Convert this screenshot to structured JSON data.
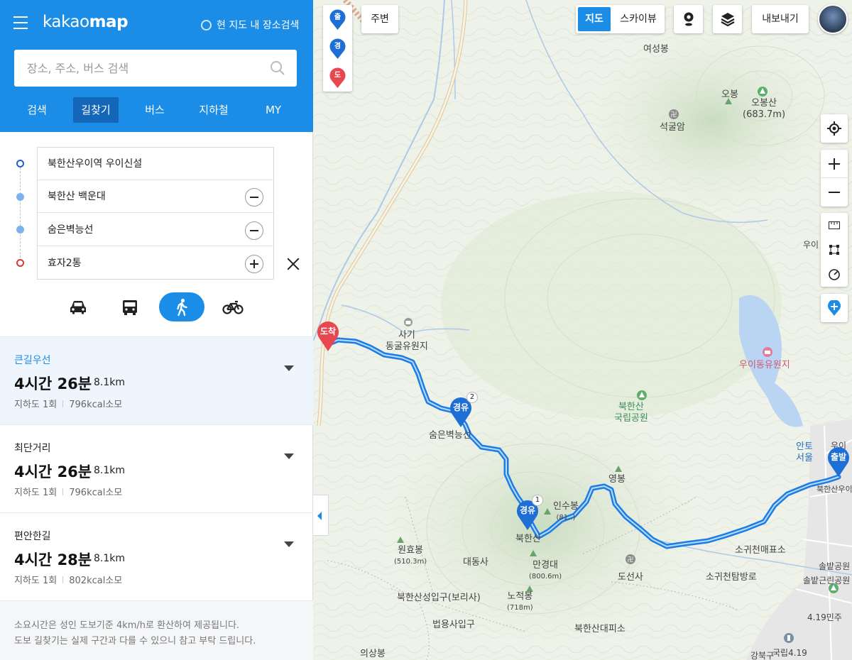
{
  "header": {
    "logo_light": "kakao",
    "logo_bold": "map",
    "scope_label": "현 지도 내 장소검색",
    "search_placeholder": "장소, 주소, 버스 검색"
  },
  "tabs": [
    "검색",
    "길찾기",
    "버스",
    "지하철",
    "MY"
  ],
  "active_tab": "길찾기",
  "route": {
    "waypoints": [
      {
        "name": "북한산우이역 우이신설",
        "action": ""
      },
      {
        "name": "북한산 백운대",
        "action": "remove"
      },
      {
        "name": "숨은벽능선",
        "action": "remove"
      },
      {
        "name": "효자2통",
        "action": "add"
      }
    ],
    "modes": [
      "car",
      "bus",
      "walk",
      "bike"
    ],
    "active_mode": "walk"
  },
  "results": [
    {
      "title": "큰길우선",
      "time": "4시간 26분",
      "distance": "8.1km",
      "underpass": "지하도 1회",
      "kcal": "796kcal소모",
      "selected": true
    },
    {
      "title": "최단거리",
      "time": "4시간 26분",
      "distance": "8.1km",
      "underpass": "지하도 1회",
      "kcal": "796kcal소모",
      "selected": false
    },
    {
      "title": "편안한길",
      "time": "4시간 28분",
      "distance": "8.1km",
      "underpass": "지하도 1회",
      "kcal": "802kcal소모",
      "selected": false
    }
  ],
  "note": {
    "line1": "소요시간은 성인 도보기준 4km/h로 환산하여 제공됩니다.",
    "line2": "도보 길찾기는 실제 구간과 다를 수 있으니 참고 부탁 드립니다."
  },
  "map_controls": {
    "pin_start": "출",
    "pin_via": "경",
    "pin_end": "도",
    "nearby": "주변",
    "map_view": "지도",
    "sky_view": "스카이뷰",
    "export": "내보내기"
  },
  "markers": {
    "start": "출발",
    "via": "경유",
    "end": "도착",
    "via_index_1": "1",
    "via_index_2": "2"
  },
  "map_labels": {
    "yeoseongbong": "여성봉",
    "obong": "오봉",
    "obongsan": "오봉산",
    "obongsan_h": "(683.7m)",
    "seokguram": "석굴암",
    "sagi_1": "사기",
    "sagi_2": "동굴유원지",
    "woui_resort": "우이동유원지",
    "bukhansan_1": "북한산",
    "bukhansan_2": "국립공원",
    "sumeun": "숨은벽능선",
    "yeongbong": "영봉",
    "insubong": "인수봉",
    "insubong_h": "(81..)",
    "bukhan_peak": "북한산",
    "wonhyobong": "원효봉",
    "wonhyobong_h": "(510.3m)",
    "daedongsa": "대동사",
    "mangyeongdae": "만경대",
    "mangyeongdae_h": "(800.6m)",
    "doseonsa": "도선사",
    "nojeokbong": "노적봉",
    "nojeokbong_h": "(718m)",
    "bohyunsa_gate": "북한산성입구(보리사)",
    "beopyongsa": "법용사입구",
    "bukhan_shelter": "북한산대피소",
    "uisangbong": "의상봉",
    "sogwi_store": "소귀천매표소",
    "sogwi_route": "소귀천탐방로",
    "anto_1": "안토",
    "anto_2": "서울",
    "bukhan_uui": "북한산우이",
    "woui_top": "우이",
    "woui_right": "우이",
    "solbat_1": "솔밭공원",
    "solbat_2": "솔밭근린공원",
    "april19": "4.19민주",
    "gukrip": "국립4.19",
    "gangbuk": "강북구"
  }
}
